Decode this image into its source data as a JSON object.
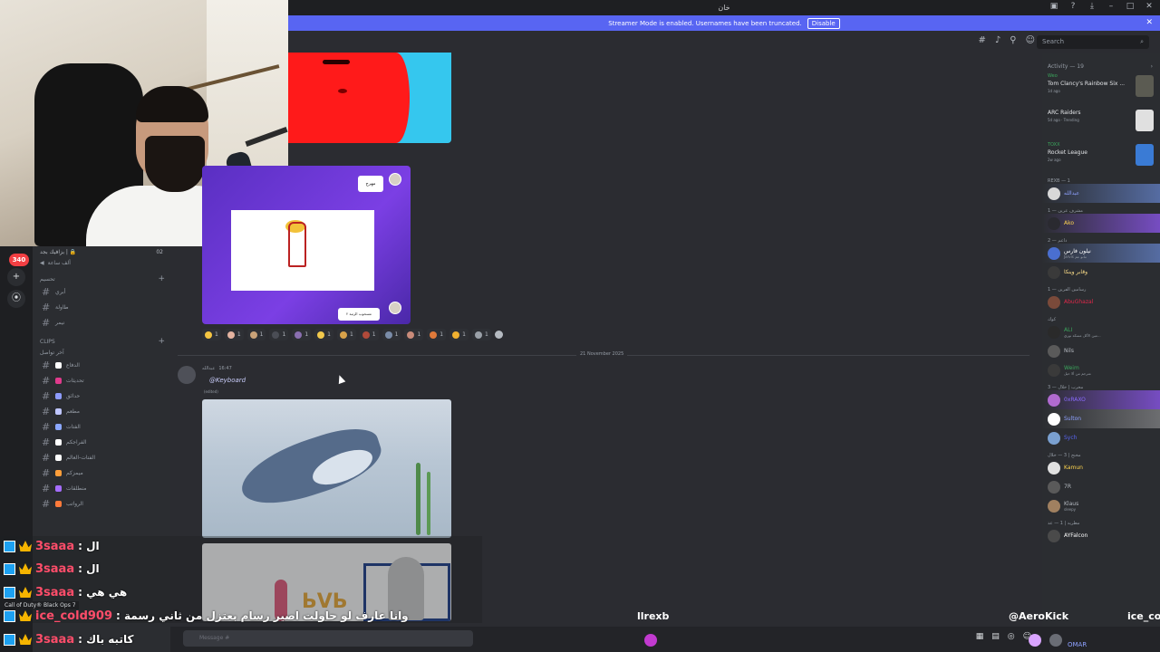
{
  "window": {
    "title": "خان",
    "controls": [
      "inbox-icon",
      "help-icon",
      "download-icon",
      "minimize-icon",
      "maximize-icon",
      "close-icon"
    ]
  },
  "streamer_banner": {
    "text": "Streamer Mode is enabled. Usernames have been truncated.",
    "button": "Disable",
    "close": "✕"
  },
  "header": {
    "search_placeholder": "Search",
    "icons": [
      "threads-icon",
      "mute-icon",
      "pin-icon",
      "members-icon"
    ]
  },
  "rail": {
    "badge": "340",
    "buttons": [
      "+",
      "⦿"
    ]
  },
  "sidebar": {
    "top_left": "بزافيك بجد | 🔒",
    "top_right": "02",
    "voice_label": "ألف ساعة",
    "category1": "تحسيم",
    "channels_top": [
      "أبري",
      "طاولة",
      "نيمر"
    ],
    "clips_category": "CLIPS",
    "sub_category": "آخر تواصل",
    "channels": [
      {
        "name": "الدفاع",
        "color": "#ffffff"
      },
      {
        "name": "تحديثات",
        "color": "#e03a8c"
      },
      {
        "name": "حدائق",
        "color": "#8e9cff"
      },
      {
        "name": "مطعم",
        "color": "#bfc6ff"
      },
      {
        "name": "الفتات",
        "color": "#8ba7ff"
      },
      {
        "name": "الفراجكم",
        "color": "#ffffff"
      },
      {
        "name": "الفتات-العالم",
        "color": "#ffffff"
      },
      {
        "name": "ميمزكم",
        "color": "#ff9f3a"
      },
      {
        "name": "منطلقات",
        "color": "#a56dff"
      },
      {
        "name": "الرواتب",
        "color": "#ff7a3a"
      }
    ]
  },
  "main": {
    "reactions": [
      {
        "count": "1",
        "color": "#f5c542"
      },
      {
        "count": "1",
        "color": "#e4b3a0"
      },
      {
        "count": "1",
        "color": "#c9a278"
      },
      {
        "count": "1",
        "color": "#4a4d55"
      },
      {
        "count": "1",
        "color": "#8a6fb0"
      },
      {
        "count": "1",
        "color": "#f2c94c"
      },
      {
        "count": "1",
        "color": "#d8a24a"
      },
      {
        "count": "1",
        "color": "#b04a3a"
      },
      {
        "count": "1",
        "color": "#7a8ca8"
      },
      {
        "count": "1",
        "color": "#c98b7a"
      },
      {
        "count": "1",
        "color": "#e07a3a"
      },
      {
        "count": "1",
        "color": "#f0b030"
      },
      {
        "count": "1",
        "color": "#9aa0a8"
      }
    ],
    "date_divider": "21 November 2025",
    "message": {
      "author": "عبدالله",
      "time": "16:47",
      "mention": "@Keyboard",
      "sub": "(edited)"
    },
    "image1_caption": "",
    "purple_bubble_top": "مهرج",
    "purple_bubble_bottom": "مسحوب الرتبة ٢",
    "cartoon_letters": "ЬVЬ"
  },
  "activity": {
    "title": "Activity — 19",
    "cards": [
      {
        "who": "Weo",
        "game": "Tom Clancy's Rainbow Six ...",
        "when": "1d ago",
        "thumb": "#5b5b52"
      },
      {
        "who": "",
        "game": "ARC Raiders",
        "when": "5d ago · Trending",
        "thumb": "#e0e0e0"
      },
      {
        "who": "TOXX",
        "game": "Rocket League",
        "when": "2w ago",
        "thumb": "#3a7bd5"
      }
    ],
    "groups": [
      {
        "label": "REXB — 1",
        "members": [
          {
            "name": "عبدالله",
            "sub": "",
            "style": "hl2",
            "color": "#8ea1ff",
            "ava": "#d8d8d8"
          }
        ]
      },
      {
        "label": "مشرف عرين — 1",
        "members": [
          {
            "name": "Ako",
            "sub": "",
            "style": "hl",
            "color": "#ffd54f",
            "ava": "#2a2a30"
          }
        ]
      },
      {
        "label": "داعم — 2",
        "members": [
          {
            "name": "نيلون فارس",
            "sub": "Jarvis مانو عم",
            "style": "hl2",
            "color": "#ffffff",
            "ava": "#4a6fd0"
          },
          {
            "name": "وقابر وينكا",
            "sub": "",
            "style": "",
            "color": "#ffe08a",
            "ava": "#3a3a3a"
          }
        ]
      },
      {
        "label": "رسامين الفرين — 1",
        "members": [
          {
            "name": "AbuGhazal",
            "sub": "",
            "style": "",
            "color": "#e0284a",
            "ava": "#7a4a3a"
          }
        ]
      },
      {
        "label": "كوك",
        "members": [
          {
            "name": "ALI",
            "sub": "مين الأكل مسكة نوري...",
            "style": "",
            "color": "#3ba55c",
            "ava": "#2a2a2a"
          },
          {
            "name": "Nils",
            "sub": "",
            "style": "",
            "color": "#b5bac1",
            "ava": "#5a5a5a"
          },
          {
            "name": "Weim",
            "sub": "مترجم من ألا حيل",
            "style": "",
            "color": "#3ba55c",
            "ava": "#3a3a3a"
          }
        ]
      },
      {
        "label": "3 — مخرب | خلال",
        "members": [
          {
            "name": "0xRAXO",
            "sub": "",
            "style": "hl",
            "color": "#8a6bff",
            "ava": "#b06ad0"
          },
          {
            "name": "Sulton",
            "sub": "",
            "style": "hl3",
            "color": "#8ea1ff",
            "ava": "#ffffff"
          },
          {
            "name": "Sych",
            "sub": "",
            "style": "",
            "color": "#5865f2",
            "ava": "#7aa0d0"
          }
        ]
      },
      {
        "label": "مخنج | 3 — خلال",
        "members": [
          {
            "name": "Kamun",
            "sub": "",
            "style": "",
            "color": "#ffd54f",
            "ava": "#e0e0e0"
          },
          {
            "name": "7R",
            "sub": "",
            "style": "",
            "color": "#b5bac1",
            "ava": "#5a5a5a"
          },
          {
            "name": "Klaus",
            "sub": "sleepy",
            "style": "",
            "color": "#b5bac1",
            "ava": "#a08060"
          }
        ]
      },
      {
        "label": "مطربه | 1 — عذ",
        "members": [
          {
            "name": "AYFalcon",
            "sub": "",
            "style": "",
            "color": "#ffffff",
            "ava": "#4a4a4a"
          }
        ]
      }
    ]
  },
  "stream_chat": [
    {
      "user": "3saaa",
      "text": ": ال"
    },
    {
      "user": "3saaa",
      "text": ": ال"
    },
    {
      "user": "3saaa",
      "text": ": هي هي"
    },
    {
      "user": "ice_cold909",
      "text": ": وانا عارف لو حاولت اصير رسام بعتزل من ثاني رسمة"
    },
    {
      "user": "3saaa",
      "text": ": كاتبه باك"
    }
  ],
  "game_tip": "Call of Duty® Black Ops 7",
  "bottom": {
    "message_placeholder": "Message #",
    "overlay_name_center": "llrexb",
    "overlay_name_aero": "@AeroKick",
    "overlay_name_ice": "ice_col",
    "omar": "OMAR"
  }
}
